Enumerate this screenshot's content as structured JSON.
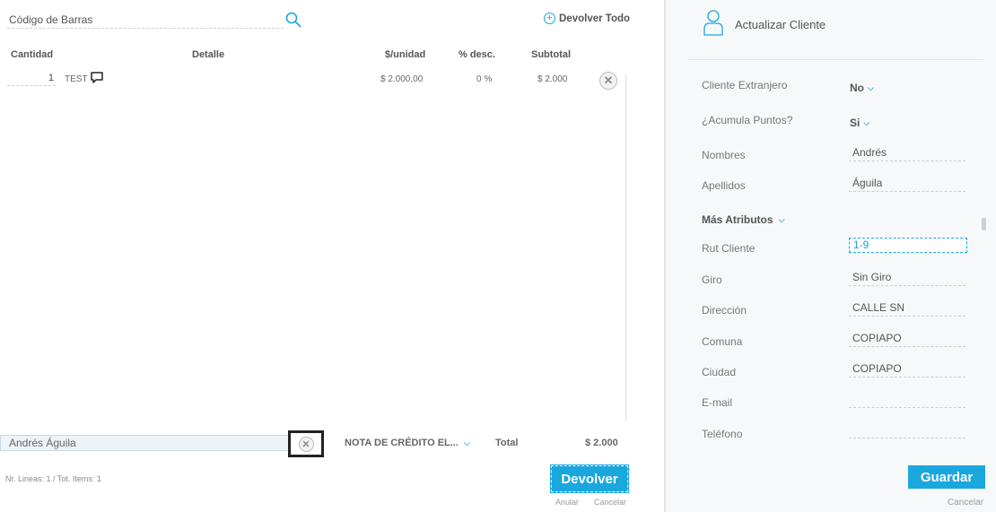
{
  "search": {
    "placeholder": "Código de Barras",
    "icon": "search-icon"
  },
  "actions": {
    "devolver_todo": "Devolver Todo"
  },
  "table": {
    "headers": [
      "Cantidad",
      "Detalle",
      "$/unidad",
      "% desc.",
      "Subtotal"
    ],
    "rows": [
      {
        "cantidad": "1",
        "detalle": "TEST",
        "unit_price": "$ 2.000,00",
        "discount": "0 %",
        "subtotal": "$ 2.000"
      }
    ]
  },
  "footer": {
    "client_name": "Andrés Águila",
    "document_type": "NOTA DE CRÉDITO EL...",
    "total_label": "Total",
    "total_value": "$ 2.000",
    "counts": "Nr. Lineas: 1 / Tot. Items: 1",
    "devolver": "Devolver",
    "anular": "Anular",
    "cancelar": "Cancelar"
  },
  "client_panel": {
    "title": "Actualizar Cliente",
    "fields": {
      "extranjero": {
        "label": "Cliente Extranjero",
        "value": "No"
      },
      "acumula": {
        "label": "¿Acumula Puntos?",
        "value": "Si"
      },
      "nombres": {
        "label": "Nombres",
        "value": "Andrés"
      },
      "apellidos": {
        "label": "Apellidos",
        "value": "Águila"
      },
      "mas_atributos": {
        "label": "Más Atributos"
      },
      "rut": {
        "label": "Rut Cliente",
        "value": "1-9"
      },
      "giro": {
        "label": "Giro",
        "value": "Sin Giro"
      },
      "direccion": {
        "label": "Dirección",
        "value": "CALLE SN"
      },
      "comuna": {
        "label": "Comuna",
        "value": "COPIAPO"
      },
      "ciudad": {
        "label": "Ciudad",
        "value": "COPIAPO"
      },
      "email": {
        "label": "E-mail",
        "value": ""
      },
      "telefono": {
        "label": "Teléfono",
        "value": ""
      }
    },
    "guardar": "Guardar",
    "cancelar": "Cancelar"
  },
  "colors": {
    "accent": "#1aa7de"
  }
}
